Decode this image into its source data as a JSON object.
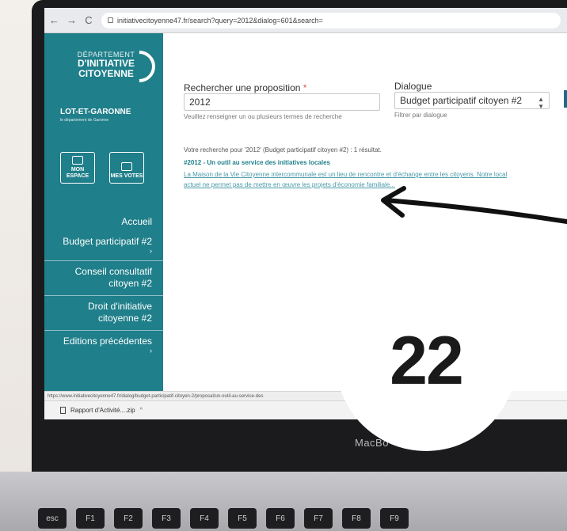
{
  "browser": {
    "nav": {
      "back": "←",
      "forward": "→",
      "reload": "C"
    },
    "url": "initiativecitoyenne47.fr/search?query=2012&dialog=601&search="
  },
  "sidebar": {
    "logo": {
      "line1": "DÉPARTEMENT",
      "line2": "D'INITIATIVE",
      "line3": "CITOYENNE"
    },
    "department": {
      "name": "LOT-ET-GARONNE",
      "tagline": "le département de Garonne"
    },
    "tiles": [
      {
        "label": "MON ESPACE",
        "icon": "user-icon"
      },
      {
        "label": "MES VOTES",
        "icon": "ballot-icon"
      }
    ],
    "menu": [
      {
        "label": "Accueil",
        "chevron": ""
      },
      {
        "label": "Budget participatif #2",
        "chevron": "›"
      },
      {
        "label": "Conseil consultatif citoyen #2",
        "chevron": ""
      },
      {
        "label": "Droit d'initiative citoyenne #2",
        "chevron": ""
      },
      {
        "label": "Editions précédentes",
        "chevron": "›"
      }
    ]
  },
  "search": {
    "label": "Rechercher une proposition",
    "required_mark": "*",
    "value": "2012",
    "help": "Veuillez renseigner un ou plusieurs termes de recherche"
  },
  "dialog_filter": {
    "label": "Dialogue",
    "selected": "Budget participatif citoyen #2",
    "help": "Filtrer par dialogue"
  },
  "results": {
    "summary": "Votre recherche pour '2012' (Budget participatif citoyen #2) : 1 résultat.",
    "items": [
      {
        "title": "#2012 - Un outil au service des initiatives locales",
        "excerpt": "La Maison de la Vie Citoyenne intercommunale est un lieu de rencontre et d'échange entre les citoyens. Notre local actuel ne permet pas de mettre en œuvre les projets d'économie familiale..."
      }
    ]
  },
  "status_bar": {
    "url": "https://www.initiativecitoyenne47.fr/dialog/budget-participatif-citoyen-2/proposal/un-outil-au-service-des"
  },
  "downloads": {
    "file": "Rapport d'Activité....zip",
    "caret": "^"
  },
  "device": {
    "brand": "MacBo",
    "keys": [
      "esc",
      "F1",
      "F2",
      "F3",
      "F4",
      "F5",
      "F6",
      "F7",
      "F8",
      "F9"
    ]
  },
  "overlay": {
    "badge_number": "22"
  },
  "colors": {
    "sidebar_teal": "#1f7f8a",
    "link_teal": "#4a9aaa",
    "required_red": "#d9534f"
  }
}
